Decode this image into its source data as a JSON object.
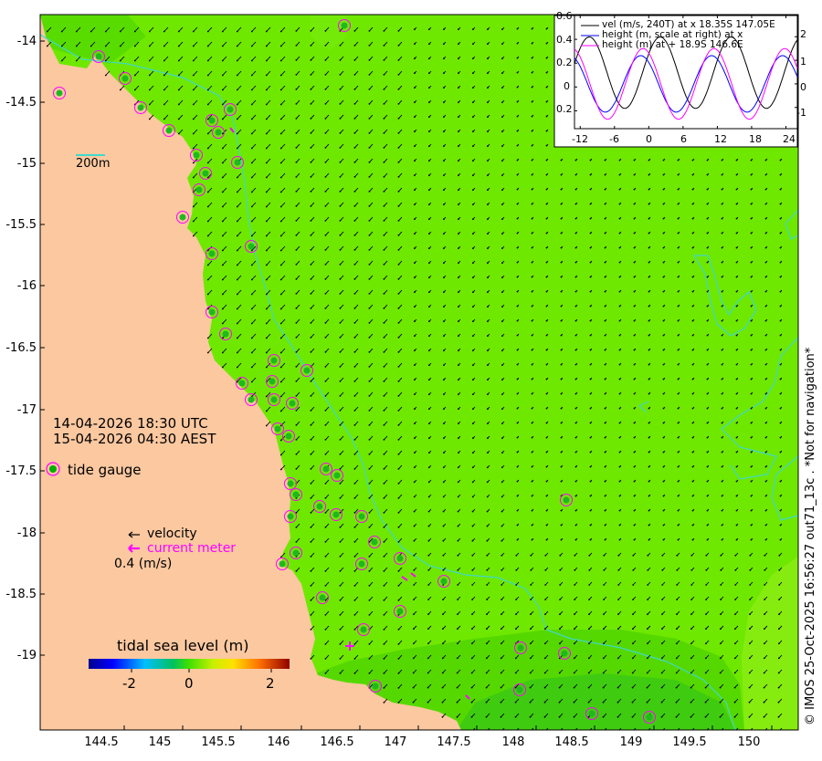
{
  "map": {
    "x_ticks": [
      "144.5",
      "145",
      "145.5",
      "146",
      "146.5",
      "147",
      "147.5",
      "148",
      "148.5",
      "149",
      "149.5",
      "150"
    ],
    "y_ticks": [
      "-14",
      "-14.5",
      "-15",
      "-15.5",
      "-16",
      "-16.5",
      "-17",
      "-17.5",
      "-18",
      "-18.5",
      "-19"
    ],
    "scale_label": "200m",
    "time_utc": "14-04-2026 18:30 UTC",
    "time_aest": "15-04-2026 04:30 AEST",
    "tide_gauge_label": "tide gauge",
    "velocity_label": "velocity",
    "current_meter_label": "current meter",
    "velocity_scale_label": "0.4 (m/s)",
    "colorbar_title": "tidal sea level (m)",
    "colorbar_ticks": [
      "-2",
      "0",
      "2"
    ],
    "credit": "© IMOS 25-Oct-2025 16:56:27 out71_13c . *Not for navigation*",
    "colors": {
      "land": "#FBC8A0",
      "sea": "#6FE800",
      "accent_magenta": "#FF00FF",
      "contour": "#40D8C8"
    }
  },
  "chart_data": {
    "type": "line",
    "x": [
      -12,
      -6,
      0,
      6,
      12,
      18,
      24
    ],
    "xlim": [
      -13,
      26
    ],
    "ylim_left": [
      -0.35,
      0.6
    ],
    "ylim_right": [
      -1.9,
      2.9
    ],
    "left_ticks": [
      "0.6",
      "0.4",
      "0.2",
      "0",
      "0.2"
    ],
    "right_ticks": [
      "2",
      "1",
      "0",
      "-1"
    ],
    "x_tick_labels": [
      "-12",
      "-6",
      "0",
      "6",
      "12",
      "18",
      "24"
    ],
    "series": [
      {
        "name": "vel (m/s, 240T) at x 18.35S 147.05E",
        "color": "#000000",
        "axis": "left",
        "amplitude": 0.3,
        "offset": 0.12,
        "period": 12.4,
        "phase_hours": 2.0
      },
      {
        "name": "height (m, scale at right) at x",
        "color": "#0000FF",
        "axis": "right",
        "amplitude": 1.2,
        "offset": 0.0,
        "period": 12.4,
        "phase_hours": -1.4
      },
      {
        "name": "height (m) at + 18.9S 146.6E",
        "color": "#FF00FF",
        "axis": "right",
        "amplitude": 1.5,
        "offset": 0.0,
        "period": 12.4,
        "phase_hours": -1.0
      }
    ]
  }
}
